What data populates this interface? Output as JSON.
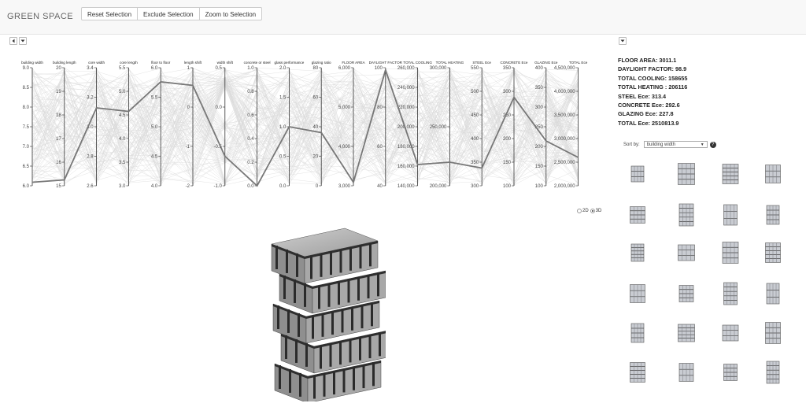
{
  "app": {
    "title": "GREEN SPACE"
  },
  "toolbar": {
    "reset_label": "Reset Selection",
    "exclude_label": "Exclude Selection",
    "zoom_label": "Zoom to Selection"
  },
  "parallel": {
    "axes": [
      {
        "name": "building width",
        "ticks": [
          "9.0",
          "8.5",
          "8.0",
          "7.5",
          "7.0",
          "6.5",
          "6.0"
        ],
        "selected": 0.97
      },
      {
        "name": "building length",
        "ticks": [
          "20",
          "19",
          "18",
          "17",
          "16",
          "15"
        ],
        "selected": 0.95
      },
      {
        "name": "core width",
        "ticks": [
          "3.4",
          "3.2",
          "3.0",
          "2.8",
          "2.6"
        ],
        "selected": 0.34
      },
      {
        "name": "core length",
        "ticks": [
          "5.5",
          "5.0",
          "4.5",
          "4.0",
          "3.5",
          "3.0"
        ],
        "selected": 0.37
      },
      {
        "name": "floor to floor",
        "ticks": [
          "6.0",
          "5.5",
          "5.0",
          "4.5",
          "4.0"
        ],
        "selected": 0.12
      },
      {
        "name": "length shift",
        "ticks": [
          "1",
          "0",
          "-1",
          "-2"
        ],
        "selected": 0.15
      },
      {
        "name": "width shift",
        "ticks": [
          "0.5",
          "0.0",
          "-0.5",
          "-1.0"
        ],
        "selected": 0.75
      },
      {
        "name": "concrete or steel",
        "ticks": [
          "1.0",
          "0.8",
          "0.6",
          "0.4",
          "0.2",
          "0.0"
        ],
        "selected": 1.0
      },
      {
        "name": "glass performance",
        "ticks": [
          "2.0",
          "1.5",
          "1.0",
          "0.5",
          "0.0"
        ],
        "selected": 0.5
      },
      {
        "name": "glazing ratio",
        "ticks": [
          "80",
          "60",
          "40",
          "20",
          "0"
        ],
        "selected": 0.55
      },
      {
        "name": "FLOOR AREA",
        "ticks": [
          "6,000",
          "5,000",
          "4,000",
          "3,000"
        ],
        "selected": 0.97
      },
      {
        "name": "DAYLIGHT FACTOR",
        "ticks": [
          "100",
          "80",
          "60",
          "40"
        ],
        "selected": 0.02
      },
      {
        "name": "TOTAL COOLING",
        "ticks": [
          "260,000",
          "240,000",
          "220,000",
          "200,000",
          "180,000",
          "160,000",
          "140,000"
        ],
        "selected": 0.82
      },
      {
        "name": "TOTAL HEATING",
        "ticks": [
          "300,000",
          "250,000",
          "200,000"
        ],
        "selected": 0.8
      },
      {
        "name": "STEEL Ece",
        "ticks": [
          "550",
          "500",
          "450",
          "400",
          "350",
          "300"
        ],
        "selected": 0.85
      },
      {
        "name": "CONCRETE Ece",
        "ticks": [
          "350",
          "300",
          "250",
          "200",
          "150",
          "100"
        ],
        "selected": 0.25
      },
      {
        "name": "GLAZING Ece",
        "ticks": [
          "400",
          "350",
          "300",
          "250",
          "200",
          "150",
          "100"
        ],
        "selected": 0.62
      },
      {
        "name": "TOTAL Ece",
        "ticks": [
          "4,500,000",
          "4,000,000",
          "3,500,000",
          "3,000,000",
          "2,500,000",
          "2,000,000"
        ],
        "selected": 0.76
      }
    ]
  },
  "stats": [
    "FLOOR AREA: 3011.1",
    "DAYLIGHT FACTOR: 98.9",
    "TOTAL COOLING: 158655",
    "TOTAL HEATING : 206116",
    "STEEL Ece: 313.4",
    "CONCRETE Ece: 292.6",
    "GLAZING Ece: 227.8",
    "TOTAL Ece: 2510813.9"
  ],
  "sort": {
    "label": "Sort by:",
    "value": "building width"
  },
  "view_toggle": {
    "option_2d": "2D",
    "option_3d": "3D",
    "selected": "3D"
  },
  "icons": {
    "prev": "caret-left-icon",
    "menu": "caret-down-icon",
    "help": "question-icon"
  }
}
